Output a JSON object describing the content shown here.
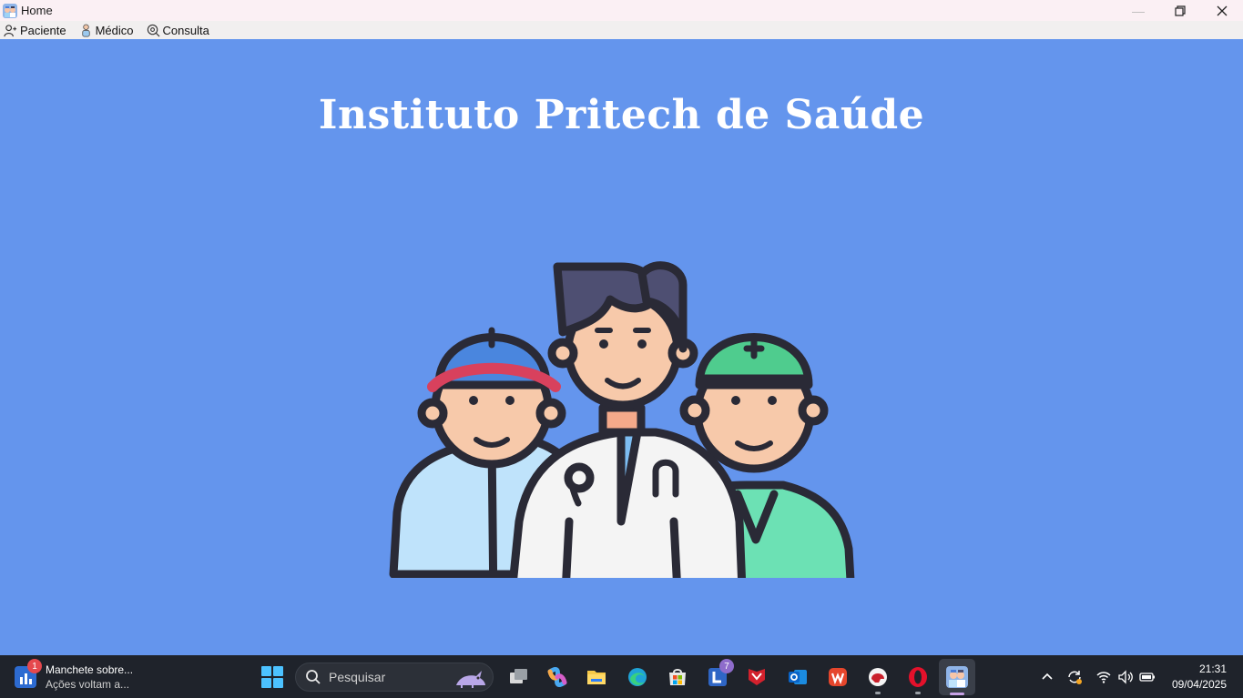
{
  "window": {
    "title": "Home",
    "icon": "app-doctors-icon",
    "controls": [
      "minimize",
      "restore",
      "close"
    ]
  },
  "menu": {
    "items": [
      {
        "label": "Paciente",
        "icon": "patient-icon"
      },
      {
        "label": "Médico",
        "icon": "doctor-icon"
      },
      {
        "label": "Consulta",
        "icon": "consultation-icon"
      }
    ]
  },
  "main": {
    "heading": "Instituto Pritech de Saúde",
    "illustration": "healthcare-team-illustration",
    "background": "#6495ED"
  },
  "taskbar": {
    "news": {
      "badge": "1",
      "line1": "Manchete sobre...",
      "line2": "Ações voltam a..."
    },
    "search_placeholder": "Pesquisar",
    "apps": [
      "task-view",
      "copilot",
      "file-explorer",
      "edge",
      "microsoft-store",
      "libreoffice",
      "mcafee",
      "outlook",
      "wps-office",
      "browser-helmet",
      "opera",
      "home-app"
    ],
    "libre_badge": "7",
    "clock": {
      "time": "21:31",
      "date": "09/04/2025"
    }
  }
}
